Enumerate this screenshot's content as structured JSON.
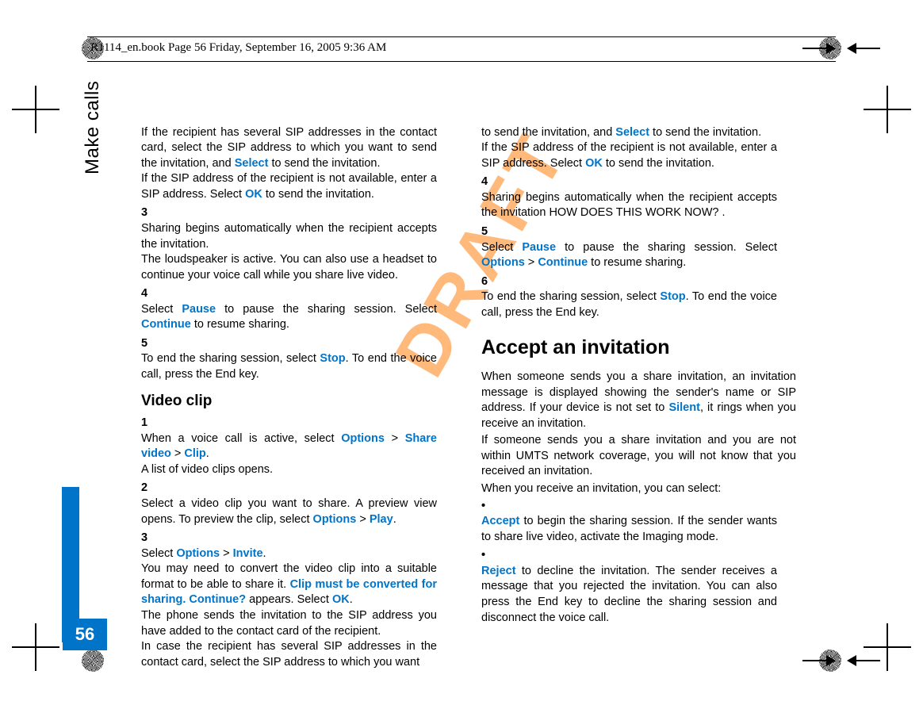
{
  "header": {
    "running": "R1114_en.book  Page 56  Friday, September 16, 2005  9:36 AM"
  },
  "sidebar": {
    "label": "Make calls",
    "page": "56"
  },
  "watermark": "DRAFT",
  "left": {
    "recipSeveral": "If the recipient has several SIP addresses in the contact card, select the SIP address to which you want to send the invitation, and ",
    "select": "Select",
    "recipSeveral2": " to send the invitation.",
    "ifNotAvail": "If the SIP address of the recipient is not available, enter a SIP address. Select ",
    "ok": "OK",
    "ifNotAvail2": " to send the invitation.",
    "n3": "3",
    "step3a": "Sharing begins automatically when the recipient accepts the invitation.",
    "step3b": "The loudspeaker is active. You can also use a headset to continue your voice call while you share live video.",
    "n4": "4",
    "step4a": "Select ",
    "pause": "Pause",
    "step4b": " to pause the sharing session. Select ",
    "continue": "Continue",
    "step4c": " to resume sharing.",
    "n5": "5",
    "step5a": "To end the sharing session, select ",
    "stop": "Stop",
    "step5b": ". To end the voice call, press the End key.",
    "videoClipHeading": "Video clip",
    "v1": "1",
    "v1a": "When a voice call is active, select ",
    "options": "Options",
    "shareVideo": "Share video",
    "clip": "Clip",
    "v1b": ".",
    "v1c": "A list of video clips opens.",
    "v2": "2",
    "v2a": "Select a video clip you want to share. A preview view opens. To preview the clip, select ",
    "play": "Play",
    "v3": "3",
    "v3a": "Select ",
    "invite": "Invite",
    "v3b": ".",
    "v3c": "You may need to convert the video clip into a suitable format to be able to share it. ",
    "clipMust": "Clip must be converted for sharing. Continue?",
    "v3d": " appears. Select ",
    "v3e": ".",
    "v3f": "The phone sends the invitation to the SIP address you have added to the contact card of the recipient.",
    "v3g": "In case the recipient has several SIP addresses in the contact card, select the SIP address to which you want"
  },
  "right": {
    "contA": "to send the invitation, and ",
    "contB": " to send the invitation.",
    "contC": "If the SIP address of the recipient is not available, enter a SIP address. Select ",
    "contD": " to send the invitation.",
    "r4": "4",
    "r4a": "Sharing begins automatically when the recipient accepts the invitation HOW DOES THIS WORK NOW? .",
    "r5": "5",
    "r5a": "Select ",
    "r5b": " to pause the sharing session. Select ",
    "r5c": " to resume sharing.",
    "r6": "6",
    "r6a": "To end the sharing session, select ",
    "r6b": ". To end the voice call, press the End key.",
    "acceptHeading": "Accept an invitation",
    "p1a": "When someone sends you a share invitation, an invitation message is displayed showing the sender's name or SIP address. If your device is not set to ",
    "silent": "Silent",
    "p1b": ", it rings when you receive an invitation.",
    "p2": "If someone sends you a share invitation and you are not within UMTS network coverage,  you will not know that you received an invitation.",
    "p3": "When you receive an invitation, you can select:",
    "accept": "Accept",
    "b1": " to begin the sharing session. If the sender wants to share live video, activate the Imaging mode.",
    "reject": "Reject",
    "b2": " to decline the invitation. The sender receives a message that you rejected the invitation. You can also press the End key to decline the sharing session and disconnect the voice call."
  },
  "sep": " > "
}
